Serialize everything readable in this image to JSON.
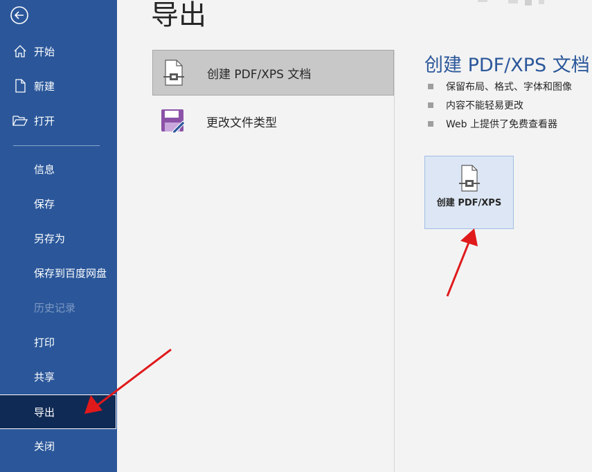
{
  "sidebar": {
    "back_icon": "back-arrow-icon",
    "items": [
      {
        "label": "开始",
        "icon": "home-icon"
      },
      {
        "label": "新建",
        "icon": "new-doc-icon"
      },
      {
        "label": "打开",
        "icon": "open-folder-icon"
      },
      {
        "label": "信息"
      },
      {
        "label": "保存"
      },
      {
        "label": "另存为"
      },
      {
        "label": "保存到百度网盘"
      },
      {
        "label": "历史记录",
        "state": "disabled"
      },
      {
        "label": "打印"
      },
      {
        "label": "共享"
      },
      {
        "label": "导出",
        "state": "active"
      },
      {
        "label": "关闭"
      }
    ]
  },
  "main": {
    "title": "导出",
    "options": [
      {
        "label": "创建 PDF/XPS 文档",
        "icon": "pdf-doc-icon",
        "selected": true
      },
      {
        "label": "更改文件类型",
        "icon": "save-filetype-icon",
        "selected": false
      }
    ],
    "detail": {
      "title": "创建 PDF/XPS 文档",
      "bullets": [
        "保留布局、格式、字体和图像",
        "内容不能轻易更改",
        "Web 上提供了免费查看器"
      ],
      "button_label": "创建 PDF/XPS"
    }
  },
  "colors": {
    "sidebar_bg": "#2b579a",
    "sidebar_active": "#0f2a55",
    "accent": "#2b579a",
    "annotation_arrow": "#e0191b"
  }
}
